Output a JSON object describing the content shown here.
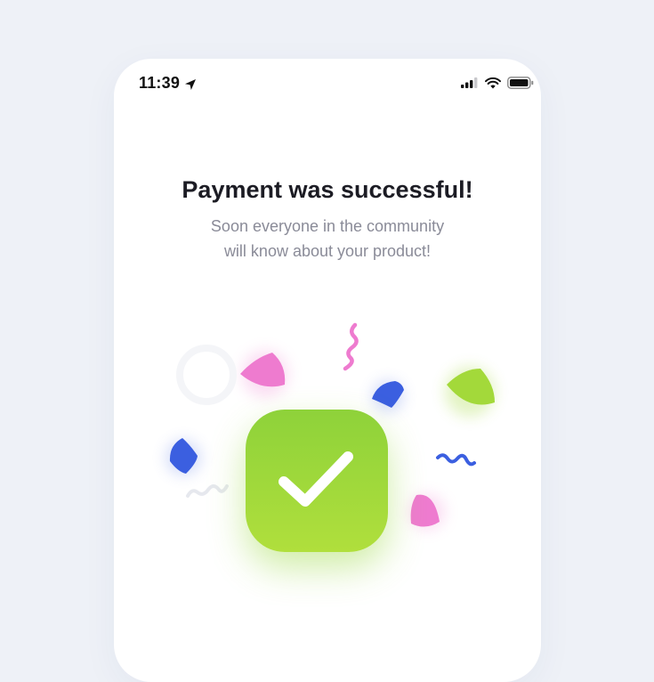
{
  "status_bar": {
    "time": "11:39",
    "icons": [
      "location-arrow-icon",
      "cellular-signal-icon",
      "wifi-icon",
      "battery-icon"
    ]
  },
  "success": {
    "title": "Payment was successful!",
    "subtitle_line1": "Soon everyone in the community",
    "subtitle_line2": "will know about your product!",
    "icon": "checkmark-icon"
  },
  "colors": {
    "background": "#eef1f7",
    "card": "#ffffff",
    "accent_green": "#9ad63a",
    "confetti_pink": "#ee7bcf",
    "confetti_blue": "#3b5fe0",
    "confetti_lime": "#a3d93a",
    "title": "#1c1c24",
    "subtitle": "#8a8b98"
  }
}
